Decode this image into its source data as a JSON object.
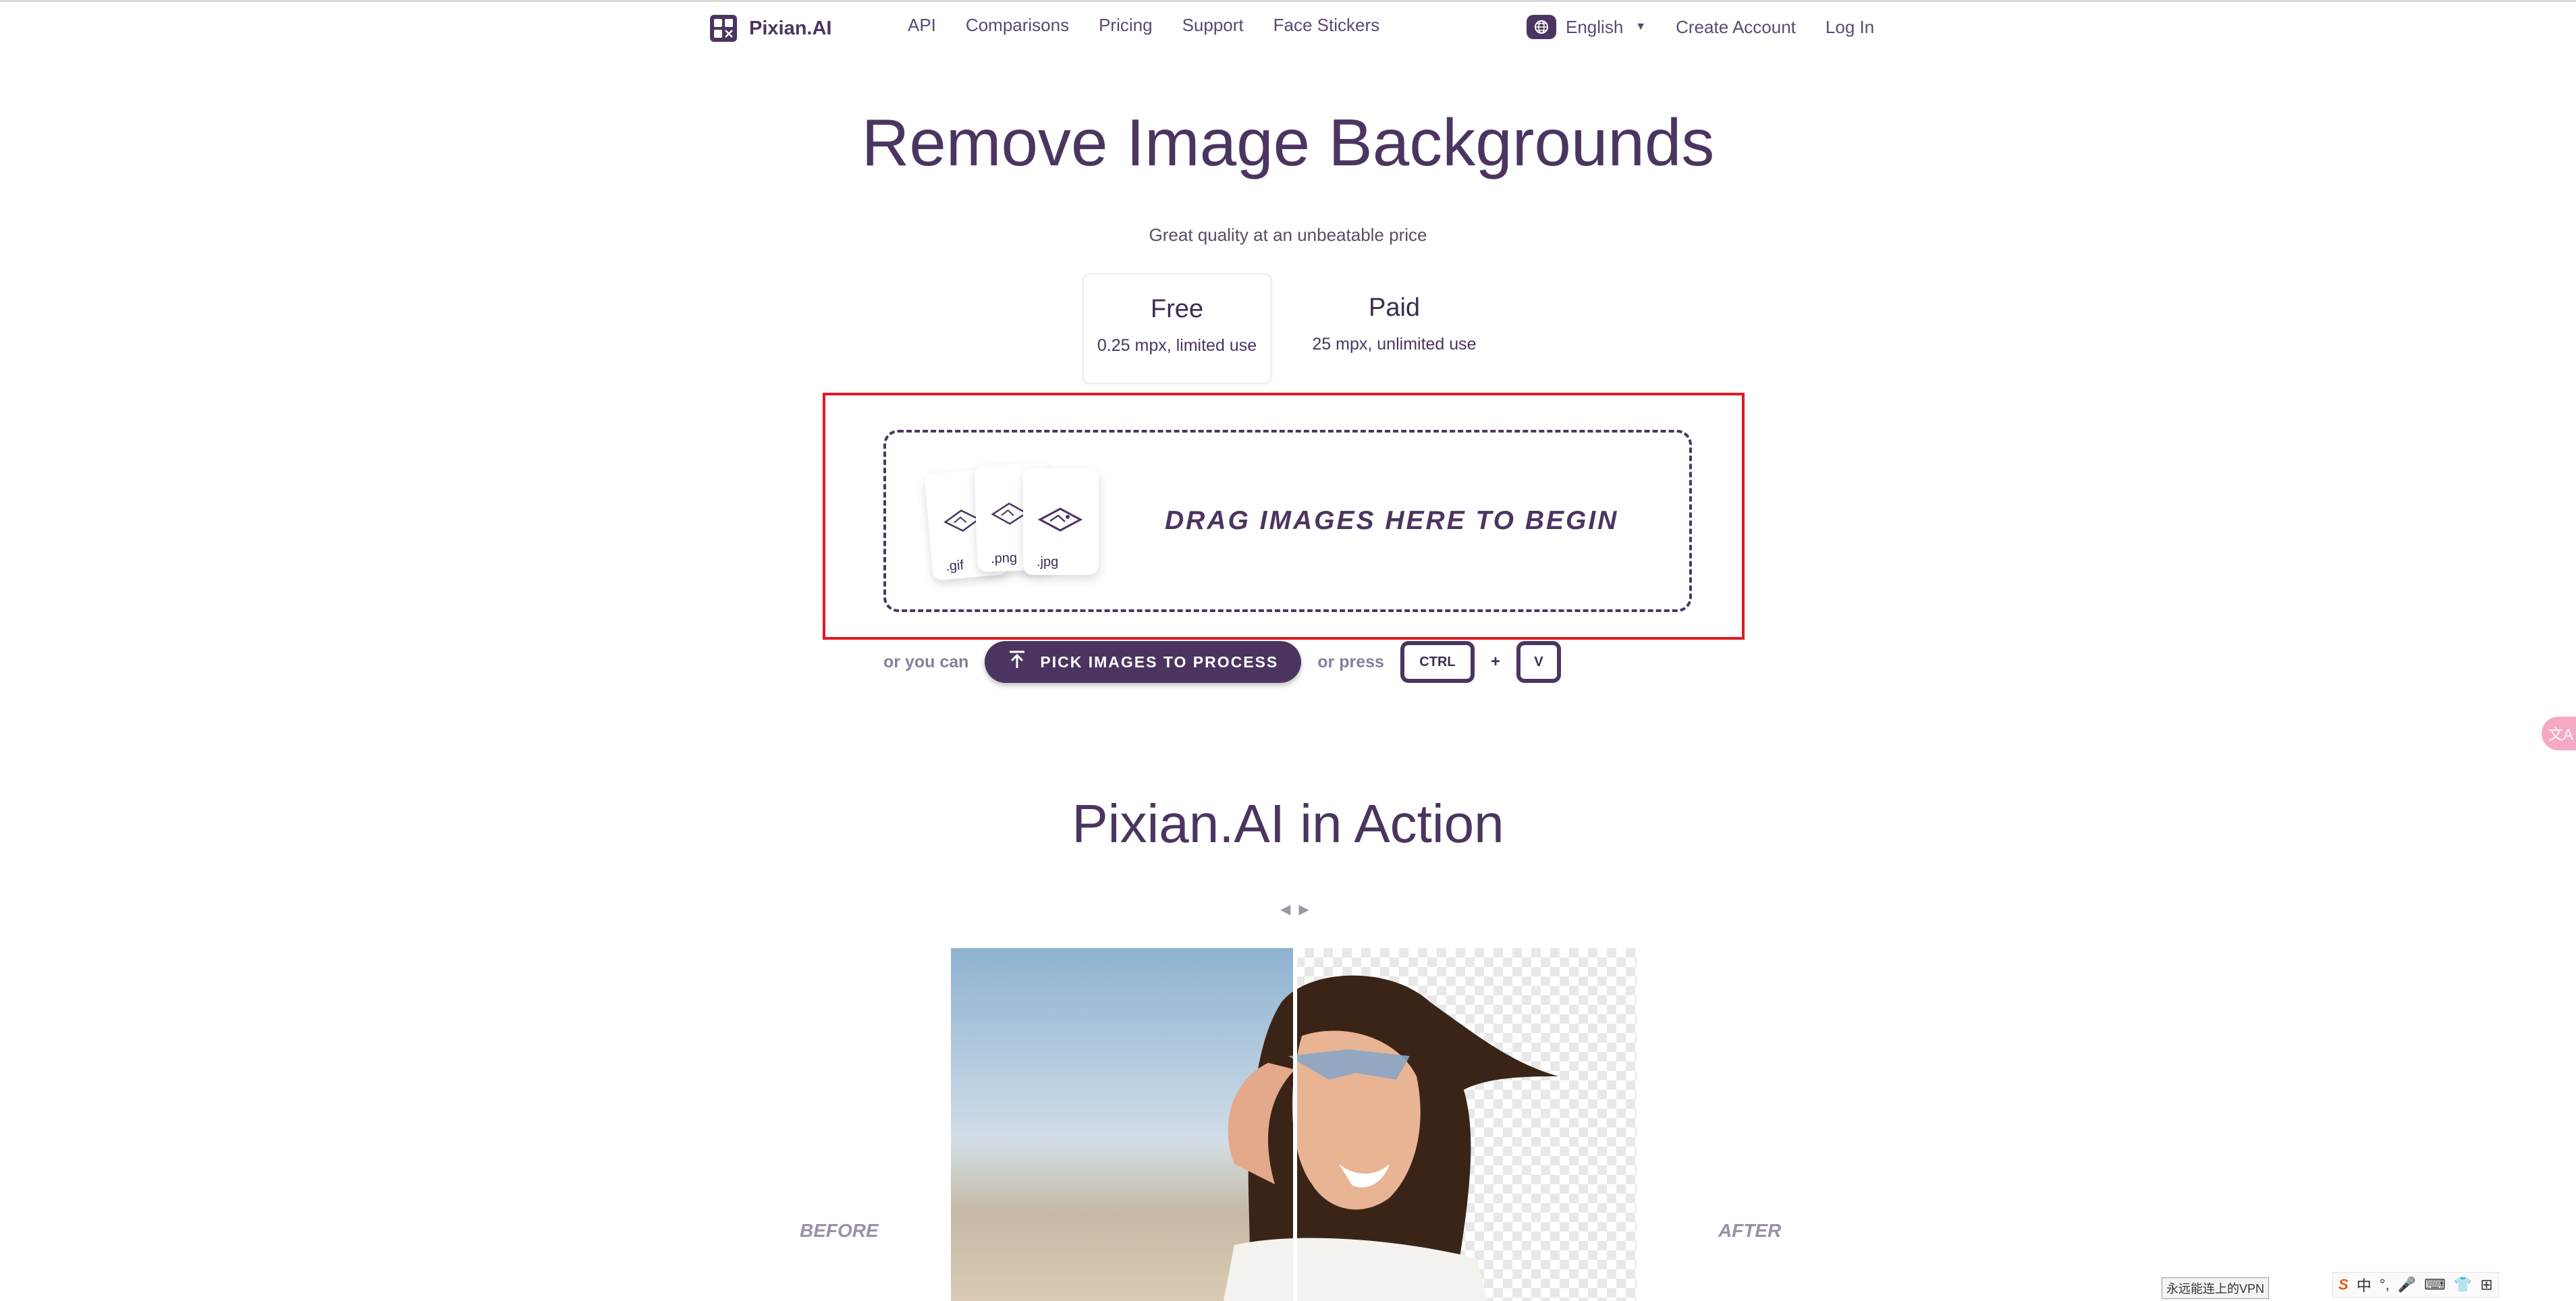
{
  "nav": {
    "brand": "Pixian.AI",
    "links": [
      "API",
      "Comparisons",
      "Pricing",
      "Support",
      "Face Stickers"
    ],
    "language": "English",
    "create_account": "Create Account",
    "log_in": "Log In"
  },
  "hero": {
    "title": "Remove Image Backgrounds",
    "subtitle": "Great quality at an unbeatable price",
    "tiers": [
      {
        "name": "Free",
        "desc": "0.25 mpx, limited use",
        "selected": true
      },
      {
        "name": "Paid",
        "desc": "25 mpx, unlimited use",
        "selected": false
      }
    ]
  },
  "dropzone": {
    "text": "DRAG IMAGES HERE TO BEGIN",
    "file_types": [
      ".gif",
      ".png",
      ".jpg"
    ]
  },
  "actions": {
    "or_you_can": "or you can",
    "pick_button": "PICK IMAGES TO PROCESS",
    "or_press": "or press",
    "key_ctrl": "CTRL",
    "plus": "+",
    "key_v": "V"
  },
  "demo": {
    "heading": "Pixian.AI in Action",
    "before_label": "BEFORE",
    "after_label": "AFTER"
  },
  "system": {
    "translate_icon_text": "文A",
    "vpn_label": "永远能连上的VPN",
    "ime_chars": [
      "S",
      "中",
      "°,",
      "🎤",
      "⌨",
      "👕",
      "⊞"
    ]
  },
  "colors": {
    "brand_purple": "#4b3560",
    "highlight_red": "#e01a22",
    "label_gray": "#9b90a8"
  }
}
